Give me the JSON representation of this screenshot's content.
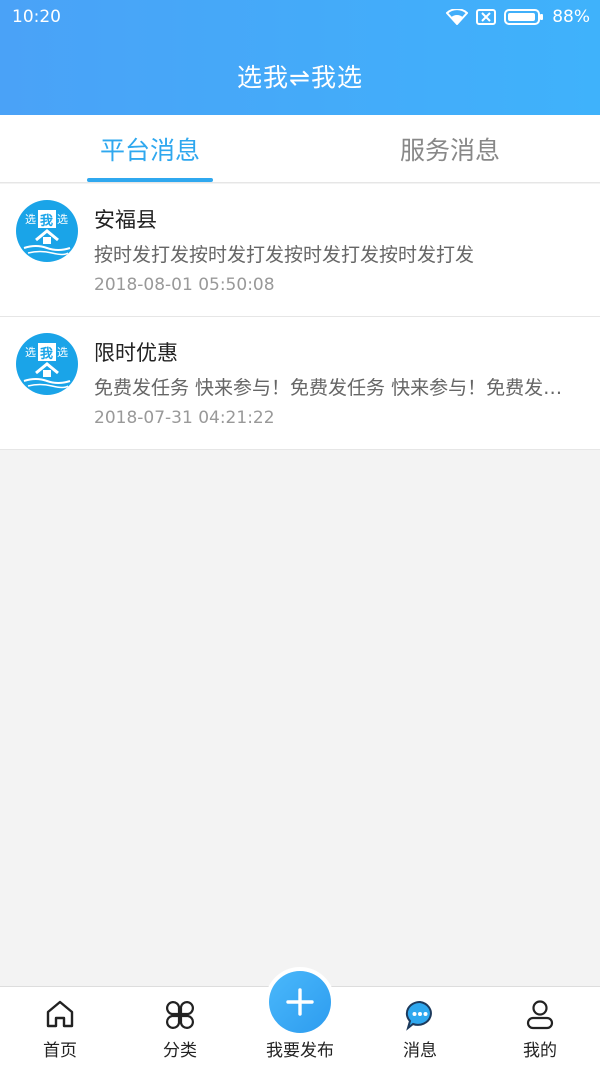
{
  "status_bar": {
    "time": "10:20",
    "battery": "88%"
  },
  "header": {
    "title": "选我⇌我选"
  },
  "tabs": [
    {
      "label": "平台消息",
      "active": true
    },
    {
      "label": "服务消息",
      "active": false
    }
  ],
  "messages": [
    {
      "avatar_text": [
        "选",
        "我",
        "选"
      ],
      "title": "安福县",
      "body": "按时发打发按时发打发按时发打发按时发打发",
      "time": "2018-08-01 05:50:08"
    },
    {
      "avatar_text": [
        "选",
        "我",
        "选"
      ],
      "title": "限时优惠",
      "body": "免费发任务 快来参与！免费发任务 快来参与！免费发任务 快来参与！",
      "time": "2018-07-31 04:21:22"
    }
  ],
  "bottom_nav": [
    {
      "label": "首页",
      "icon": "home-icon"
    },
    {
      "label": "分类",
      "icon": "category-icon"
    },
    {
      "label": "我要发布",
      "icon": "plus-icon"
    },
    {
      "label": "消息",
      "icon": "message-icon"
    },
    {
      "label": "我的",
      "icon": "user-icon"
    }
  ],
  "colors": {
    "accent": "#2fa8ef",
    "header_start": "#4aa2f7",
    "header_end": "#3fb2fb"
  }
}
